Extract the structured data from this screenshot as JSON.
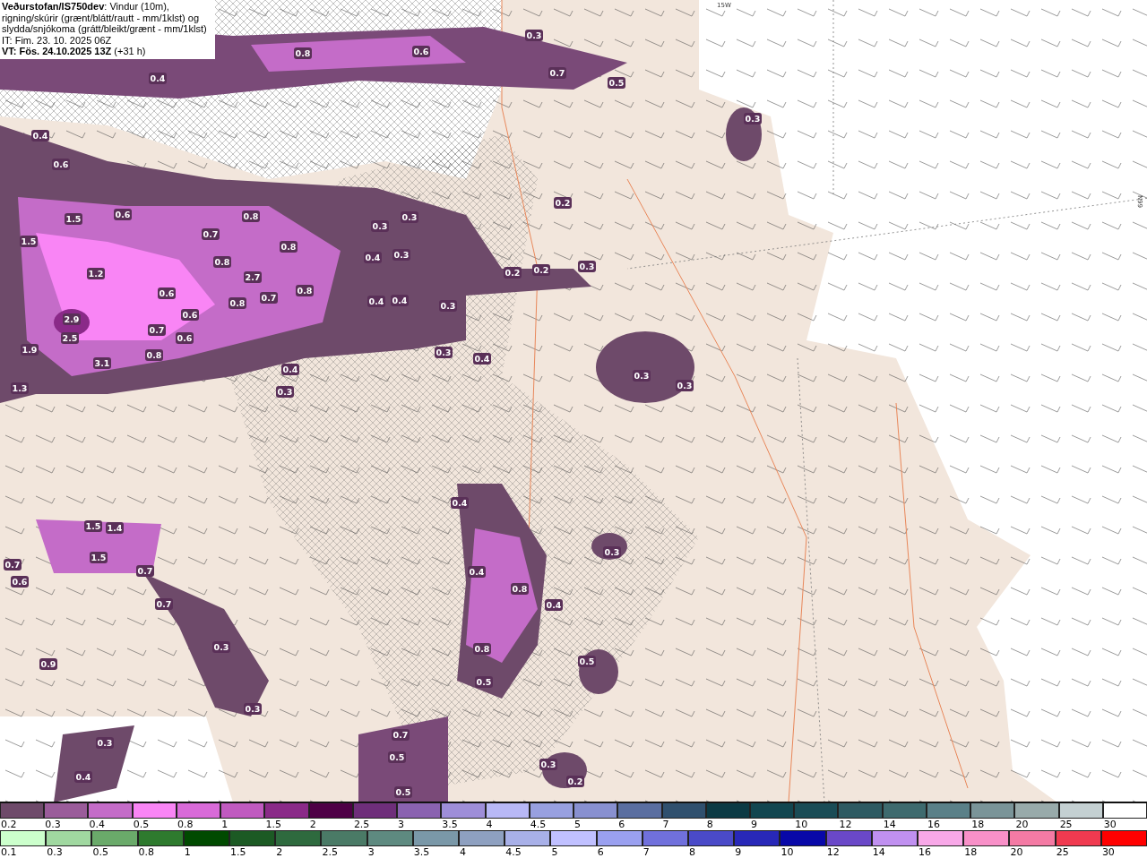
{
  "header": {
    "description": "**Veðurstofan/IS750dev**: Vindur (10m), rigning/skúrir (grænt/blátt/rautt - mm/1klst) og slydda/snjókoma (grátt/bleikt/grænt - mm/1klst)",
    "issue_time": "IT: Fim. 23. 10. 2025 06Z",
    "valid_time": "**VT: Fös. 24.10.2025 13Z** (+31 h)"
  },
  "map": {
    "grid_labels": [
      "15W",
      "66N"
    ],
    "values": [
      "0.8",
      "0.6",
      "0.3",
      "0.7",
      "0.5",
      "0.4",
      "0.4",
      "0.6",
      "0.3",
      "1.5",
      "0.6",
      "1.5",
      "0.7",
      "0.8",
      "0.8",
      "0.8",
      "0.3",
      "0.3",
      "0.4",
      "0.3",
      "2.7",
      "1.2",
      "0.2",
      "0.2",
      "0.3",
      "0.2",
      "0.8",
      "0.7",
      "0.8",
      "0.4",
      "0.4",
      "0.3",
      "0.6",
      "0.6",
      "2.9",
      "2.5",
      "0.7",
      "0.6",
      "1.9",
      "0.8",
      "3.1",
      "0.3",
      "0.4",
      "0.3",
      "0.3",
      "0.4",
      "0.3",
      "1.3",
      "0.4",
      "1.5",
      "1.4",
      "1.5",
      "0.7",
      "0.7",
      "0.6",
      "0.3",
      "0.4",
      "0.8",
      "0.4",
      "0.7",
      "0.3",
      "0.8",
      "0.5",
      "0.9",
      "0.5",
      "0.3",
      "0.7",
      "0.3",
      "0.5",
      "0.3",
      "0.4",
      "0.2",
      "0.5"
    ]
  },
  "legend_snow": [
    {
      "label": "0.2",
      "color": "#6e4a6a"
    },
    {
      "label": "0.3",
      "color": "#9a5c9a"
    },
    {
      "label": "0.4",
      "color": "#c46cc8"
    },
    {
      "label": "0.5",
      "color": "#f985f5"
    },
    {
      "label": "0.8",
      "color": "#d86ad8"
    },
    {
      "label": "1",
      "color": "#c05ac0"
    },
    {
      "label": "1.5",
      "color": "#8a2a88"
    },
    {
      "label": "2",
      "color": "#4e0046"
    },
    {
      "label": "2.5",
      "color": "#6e2e7a"
    },
    {
      "label": "3",
      "color": "#8a62b0"
    },
    {
      "label": "3.5",
      "color": "#9e8ed8"
    },
    {
      "label": "4",
      "color": "#b8b8f6"
    },
    {
      "label": "4.5",
      "color": "#98a0e0"
    },
    {
      "label": "5",
      "color": "#8890d0"
    },
    {
      "label": "6",
      "color": "#5a6ea0"
    },
    {
      "label": "7",
      "color": "#30506e"
    },
    {
      "label": "8",
      "color": "#0c3a44"
    },
    {
      "label": "9",
      "color": "#124650"
    },
    {
      "label": "10",
      "color": "#1a4c56"
    },
    {
      "label": "12",
      "color": "#2e5a62"
    },
    {
      "label": "14",
      "color": "#3e6a6e"
    },
    {
      "label": "16",
      "color": "#5a8088"
    },
    {
      "label": "18",
      "color": "#7a9498"
    },
    {
      "label": "20",
      "color": "#98aaaa"
    },
    {
      "label": "25",
      "color": "#c4d0d2"
    },
    {
      "label": "30",
      "color": "#ffffff"
    }
  ],
  "legend_rain": [
    {
      "label": "0.1",
      "color": "#ccffcc"
    },
    {
      "label": "0.3",
      "color": "#a0d8a0"
    },
    {
      "label": "0.5",
      "color": "#6aaa6a"
    },
    {
      "label": "0.8",
      "color": "#2e7a2e"
    },
    {
      "label": "1",
      "color": "#004a00"
    },
    {
      "label": "1.5",
      "color": "#1c5a24"
    },
    {
      "label": "2",
      "color": "#2e6a3e"
    },
    {
      "label": "2.5",
      "color": "#4a7a66"
    },
    {
      "label": "3",
      "color": "#5e8a80"
    },
    {
      "label": "3.5",
      "color": "#7a98a8"
    },
    {
      "label": "4",
      "color": "#8ea0c0"
    },
    {
      "label": "4.5",
      "color": "#a8b0e8"
    },
    {
      "label": "5",
      "color": "#c0c0ff"
    },
    {
      "label": "6",
      "color": "#9aa0f0"
    },
    {
      "label": "7",
      "color": "#7070dc"
    },
    {
      "label": "8",
      "color": "#4a4ac8"
    },
    {
      "label": "9",
      "color": "#2828b8"
    },
    {
      "label": "10",
      "color": "#0808a8"
    },
    {
      "label": "12",
      "color": "#6a48c8"
    },
    {
      "label": "14",
      "color": "#c090f0"
    },
    {
      "label": "16",
      "color": "#f8a8e8"
    },
    {
      "label": "18",
      "color": "#f890c8"
    },
    {
      "label": "20",
      "color": "#f47aa4"
    },
    {
      "label": "25",
      "color": "#f03a50"
    },
    {
      "label": "30",
      "color": "#ff0000"
    }
  ]
}
